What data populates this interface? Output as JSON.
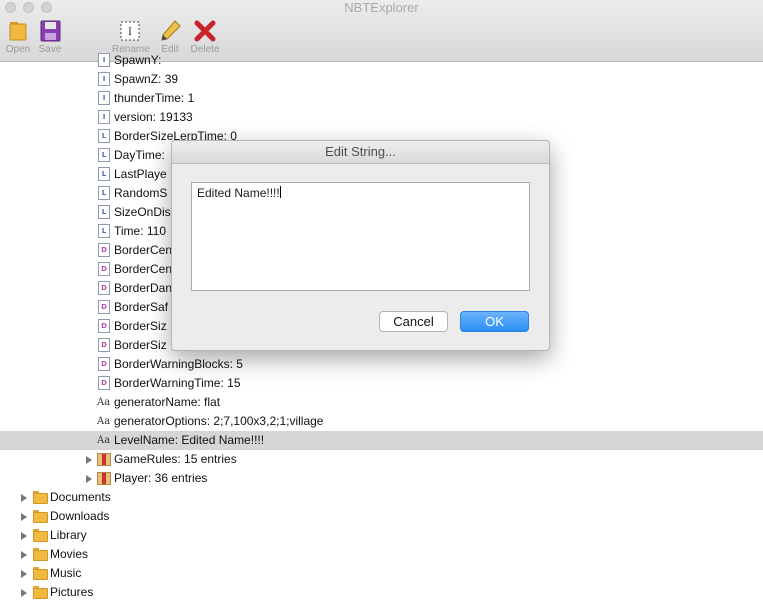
{
  "window": {
    "title": "NBTExplorer"
  },
  "toolbar": {
    "open": "Open",
    "save": "Save",
    "rename": "Rename",
    "edit": "Edit",
    "delete": "Delete"
  },
  "tree": {
    "rows": [
      {
        "icon": "int-tag-icon",
        "text": "SpawnY: "
      },
      {
        "icon": "int-tag-icon",
        "text": "SpawnZ: 39"
      },
      {
        "icon": "int-tag-icon",
        "text": "thunderTime: 1"
      },
      {
        "icon": "int-tag-icon",
        "text": "version: 19133"
      },
      {
        "icon": "long-tag-icon",
        "text": "BorderSizeLerpTime: 0"
      },
      {
        "icon": "long-tag-icon",
        "text": "DayTime:"
      },
      {
        "icon": "long-tag-icon",
        "text": "LastPlaye"
      },
      {
        "icon": "long-tag-icon",
        "text": "RandomS"
      },
      {
        "icon": "long-tag-icon",
        "text": "SizeOnDis"
      },
      {
        "icon": "long-tag-icon",
        "text": "Time: 110"
      },
      {
        "icon": "double-tag-icon",
        "text": "BorderCen"
      },
      {
        "icon": "double-tag-icon",
        "text": "BorderCen"
      },
      {
        "icon": "double-tag-icon",
        "text": "BorderDan"
      },
      {
        "icon": "double-tag-icon",
        "text": "BorderSaf"
      },
      {
        "icon": "double-tag-icon",
        "text": "BorderSiz"
      },
      {
        "icon": "double-tag-icon",
        "text": "BorderSiz"
      },
      {
        "icon": "double-tag-icon",
        "text": "BorderWarningBlocks: 5"
      },
      {
        "icon": "double-tag-icon",
        "text": "BorderWarningTime: 15"
      },
      {
        "icon": "string-tag-icon",
        "text": "generatorName: flat"
      },
      {
        "icon": "string-tag-icon",
        "text": "generatorOptions: 2;7,100x3,2;1;village"
      },
      {
        "icon": "string-tag-icon",
        "text": "LevelName: Edited Name!!!!",
        "selected": true
      },
      {
        "icon": "compound-tag-icon",
        "text": "GameRules: 15 entries"
      },
      {
        "icon": "compound-tag-icon",
        "text": "Player: 36 entries"
      }
    ],
    "folders": [
      {
        "icon": "folder-icon",
        "text": "Documents"
      },
      {
        "icon": "folder-icon",
        "text": "Downloads"
      },
      {
        "icon": "folder-icon",
        "text": "Library"
      },
      {
        "icon": "folder-icon",
        "text": "Movies"
      },
      {
        "icon": "folder-icon",
        "text": "Music"
      },
      {
        "icon": "folder-icon",
        "text": "Pictures"
      }
    ]
  },
  "dialog": {
    "title": "Edit String...",
    "value": "Edited Name!!!!",
    "cancel": "Cancel",
    "ok": "OK"
  },
  "colors": {
    "accent": "#2b8ff5",
    "selection": "#d6d6d6"
  }
}
